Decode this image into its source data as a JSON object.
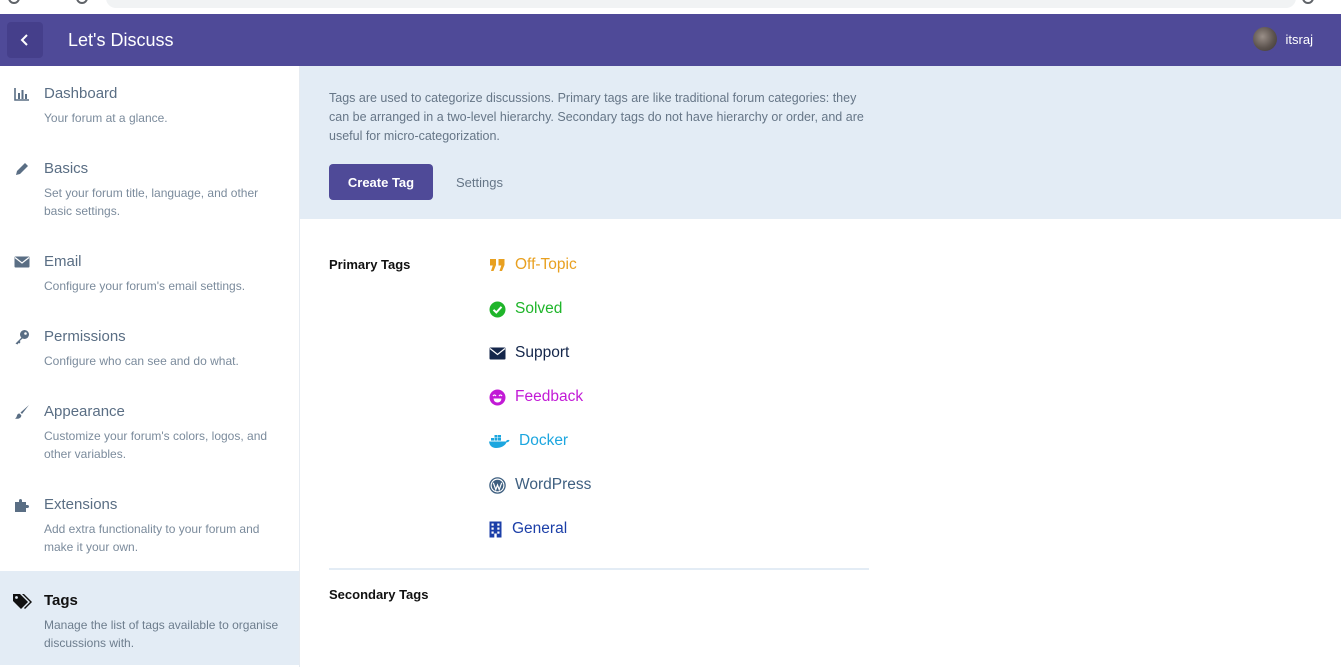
{
  "app": {
    "title": "Let's Discuss"
  },
  "user": {
    "name": "itsraj"
  },
  "sidebar": {
    "items": [
      {
        "title": "Dashboard",
        "desc": "Your forum at a glance.",
        "icon": "bar-chart-icon"
      },
      {
        "title": "Basics",
        "desc": "Set your forum title, language, and other basic settings.",
        "icon": "pencil-icon"
      },
      {
        "title": "Email",
        "desc": "Configure your forum's email settings.",
        "icon": "envelope-icon"
      },
      {
        "title": "Permissions",
        "desc": "Configure who can see and do what.",
        "icon": "key-icon"
      },
      {
        "title": "Appearance",
        "desc": "Customize your forum's colors, logos, and other variables.",
        "icon": "paintbrush-icon"
      },
      {
        "title": "Extensions",
        "desc": "Add extra functionality to your forum and make it your own.",
        "icon": "puzzle-icon"
      },
      {
        "title": "Tags",
        "desc": "Manage the list of tags available to organise discussions with.",
        "icon": "tags-icon",
        "active": true
      }
    ]
  },
  "main": {
    "intro": "Tags are used to categorize discussions. Primary tags are like traditional forum categories: they can be arranged in a two-level hierarchy. Secondary tags do not have hierarchy or order, and are useful for micro-categorization.",
    "create_label": "Create Tag",
    "settings_label": "Settings",
    "primary_label": "Primary Tags",
    "secondary_label": "Secondary Tags",
    "primary_tags": [
      {
        "name": "Off-Topic",
        "icon": "quote-icon",
        "color": "#e8a020"
      },
      {
        "name": "Solved",
        "icon": "check-circle-icon",
        "color": "#1fb52a"
      },
      {
        "name": "Support",
        "icon": "envelope-icon",
        "color": "#14264a"
      },
      {
        "name": "Feedback",
        "icon": "smile-icon",
        "color": "#c21ad6"
      },
      {
        "name": "Docker",
        "icon": "docker-icon",
        "color": "#1ca6df"
      },
      {
        "name": "WordPress",
        "icon": "wordpress-icon",
        "color": "#3e5f80"
      },
      {
        "name": "General",
        "icon": "building-icon",
        "color": "#1c3fa8"
      }
    ]
  },
  "colors": {
    "header": "#4f4a98",
    "panel": "#e3ecf5",
    "muted_text": "#667687"
  }
}
